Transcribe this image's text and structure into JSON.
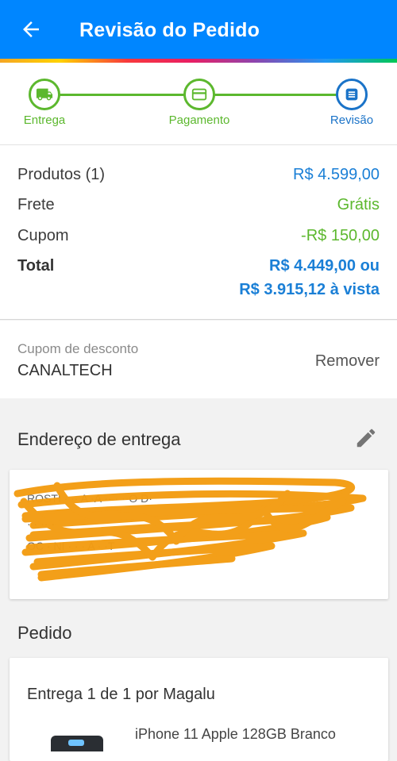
{
  "header": {
    "title": "Revisão do Pedido"
  },
  "steps": [
    {
      "label": "Entrega"
    },
    {
      "label": "Pagamento"
    },
    {
      "label": "Revisão"
    }
  ],
  "summary": {
    "products_label": "Produtos (1)",
    "products_value": "R$ 4.599,00",
    "shipping_label": "Frete",
    "shipping_value": "Grátis",
    "coupon_label": "Cupom",
    "coupon_value": "-R$ 150,00",
    "total_label": "Total",
    "total_value": "R$ 4.449,00 ou",
    "total_cash": "R$ 3.915,12 à vista"
  },
  "coupon": {
    "caption": "Cupom de desconto",
    "code": "CANALTECH",
    "remove_label": "Remover"
  },
  "address": {
    "title": "Endereço de entrega",
    "lines": [
      "ROSTI  ·  ··  A  ·A  ··  ·  ··O D·",
      "·  ·  ··  ·",
      "OC  ·  NI  ·  ·  · A  ·  ·T"
    ]
  },
  "order": {
    "title": "Pedido",
    "delivery_heading": "Entrega 1 de 1 por Magalu",
    "product_name": "iPhone 11 Apple 128GB Branco"
  },
  "colors": {
    "primary": "#0086ff",
    "accent_blue": "#1a7fd6",
    "success_green": "#5cb82e",
    "scribble_orange": "#f39c12"
  },
  "icons": {
    "back": "arrow-left-icon",
    "step1": "truck-icon",
    "step2": "card-icon",
    "step3": "list-icon",
    "edit": "pencil-icon"
  }
}
